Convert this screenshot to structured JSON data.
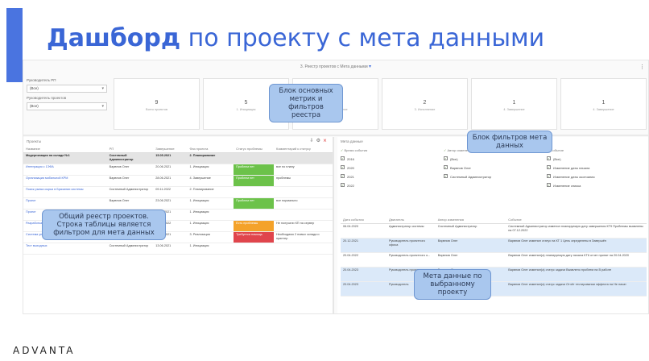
{
  "slide": {
    "title_bold": "Дашборд",
    "title_rest": " по проекту с мета данными",
    "logo": "ADVANTA"
  },
  "dashboard": {
    "title": "3. Реестр проектов с Мета данными",
    "more": "⋮",
    "filters": [
      {
        "label": "Руководитель РП",
        "value": "(Все)"
      },
      {
        "label": "Руководитель проектов",
        "value": "(Все)"
      }
    ],
    "metrics": [
      {
        "value": "9",
        "label": "Всего проектов"
      },
      {
        "value": "5",
        "label": "1. Инициация"
      },
      {
        "value": "1",
        "label": "2. Планирование"
      },
      {
        "value": "2",
        "label": "3. Исполнение"
      },
      {
        "value": "1",
        "label": "4. Завершение"
      },
      {
        "value": "1",
        "label": "4. Завершение"
      }
    ]
  },
  "projects": {
    "title": "Проекты",
    "columns": [
      "Название",
      "РП",
      "Завершение",
      "Фаз проекта",
      "Статус проблемы",
      "Комментарий к статусу"
    ],
    "rows": [
      {
        "name": "Модернизация на складе №1",
        "pm": "Системный Администратор",
        "end": "15.05.2021",
        "phase": "2. Планирование",
        "status": "",
        "status_class": "",
        "comment": "",
        "selected": true
      },
      {
        "name": "Интеграция с 1ЭФА",
        "pm": "Варвнов Олег",
        "end": "20.06.2021",
        "phase": "1. Инициация",
        "status": "Проблем нет",
        "status_class": "st-green",
        "comment": "все по плану",
        "selected": false
      },
      {
        "name": "Организация мобильной КРМ",
        "pm": "Варвнов Олег",
        "end": "28.06.2021",
        "phase": "4. Завершение",
        "status": "Проблем нет",
        "status_class": "st-green",
        "comment": "проблемы",
        "selected": false
      },
      {
        "name": "Поиск рынка сырья в Бразилии системы",
        "pm": "Системный Администратор",
        "end": "09.11.2022",
        "phase": "2. Планирование",
        "status": "",
        "status_class": "",
        "comment": "",
        "selected": false
      },
      {
        "name": "Проект",
        "pm": "Варвнов Олег",
        "end": "23.06.2021",
        "phase": "1. Инициация",
        "status": "Проблем нет",
        "status_class": "st-green",
        "comment": "все нормально",
        "selected": false
      },
      {
        "name": "Проект",
        "pm": "Варвнов Олег",
        "end": "20.06.2021",
        "phase": "1. Инициация",
        "status": "",
        "status_class": "",
        "comment": "",
        "selected": false
      },
      {
        "name": "Разработка системы автоматизации отделов складов",
        "pm": "Системный Администратор",
        "end": "30.08.2022",
        "phase": "1. Инициация",
        "status": "Есть проблемы",
        "status_class": "st-orange",
        "comment": "Не получили КП на сервер",
        "selected": false
      },
      {
        "name": "Система управления складом",
        "pm": "Чернов Михаил",
        "end": "23.08.2021",
        "phase": "3. Реализация",
        "status": "Требуется помощь",
        "status_class": "st-red",
        "comment": "Необходимо 2 новых склада и принтер",
        "selected": false
      },
      {
        "name": "Тест выходных",
        "pm": "Системный Администратор",
        "end": "13.06.2021",
        "phase": "1. Инициация",
        "status": "",
        "status_class": "",
        "comment": "",
        "selected": false
      }
    ]
  },
  "meta": {
    "title": "Мета данные",
    "filter_cols": [
      {
        "header": "Время события",
        "items": [
          "2016",
          "2020",
          "2021",
          "2022"
        ]
      },
      {
        "header": "Автор изменения",
        "items": [
          "(Все)",
          "Варвнов Олег",
          "Системный Администратор"
        ]
      },
      {
        "header": "Событие",
        "items": [
          "(Все)",
          "Изменение даты начала",
          "Изменение даты окончания",
          "Изменение списка"
        ]
      }
    ],
    "columns": [
      "Дата события",
      "Двигатель",
      "Автор изменения",
      "Событие"
    ],
    "rows": [
      {
        "date": "06.04.2020",
        "who": "Администратор системы",
        "author": "Системный Администратор",
        "event": "Системный Администратор изменил планируемую дату завершения КТ9 Проблемы выявлены на 07.12.2022",
        "hl": false
      },
      {
        "date": "20.12.2021",
        "who": "Руководитель проектного офиса",
        "author": "Варвнов Олег",
        "event": "Варвнов Олег изменил статус на КТ 1 Цель определены в Завершён",
        "hl": true
      },
      {
        "date": "20.04.2022",
        "who": "Руководитель проектного о...",
        "author": "Варвнов Олег",
        "event": "Варвнов Олег изменил(а) планируемую дату начала КТ6 отчет принят на 20.04.2020",
        "hl": false
      },
      {
        "date": "20.04.2023",
        "who": "Руководитель проектного о...",
        "author": "Варвнов Олег",
        "event": "Варвнов Олег изменил(а) статус задачи Выявлено проблем на В работе",
        "hl": true
      },
      {
        "date": "20.04.2023",
        "who": "Руководитель",
        "author": "Варвнов Олег",
        "event": "Варвнов Олег изменил(а) статус задачи Отчёт тестировании эффекта на Не начат",
        "hl": true
      }
    ]
  },
  "callouts": {
    "metrics": "Блок основных метрик и фильтров реестра",
    "meta_filters": "Блок фильтров мета данных",
    "registry": "Общий реестр проектов. Строка таблицы является фильтром для мета данных",
    "meta_selected": "Мета данные по выбранному проекту"
  }
}
